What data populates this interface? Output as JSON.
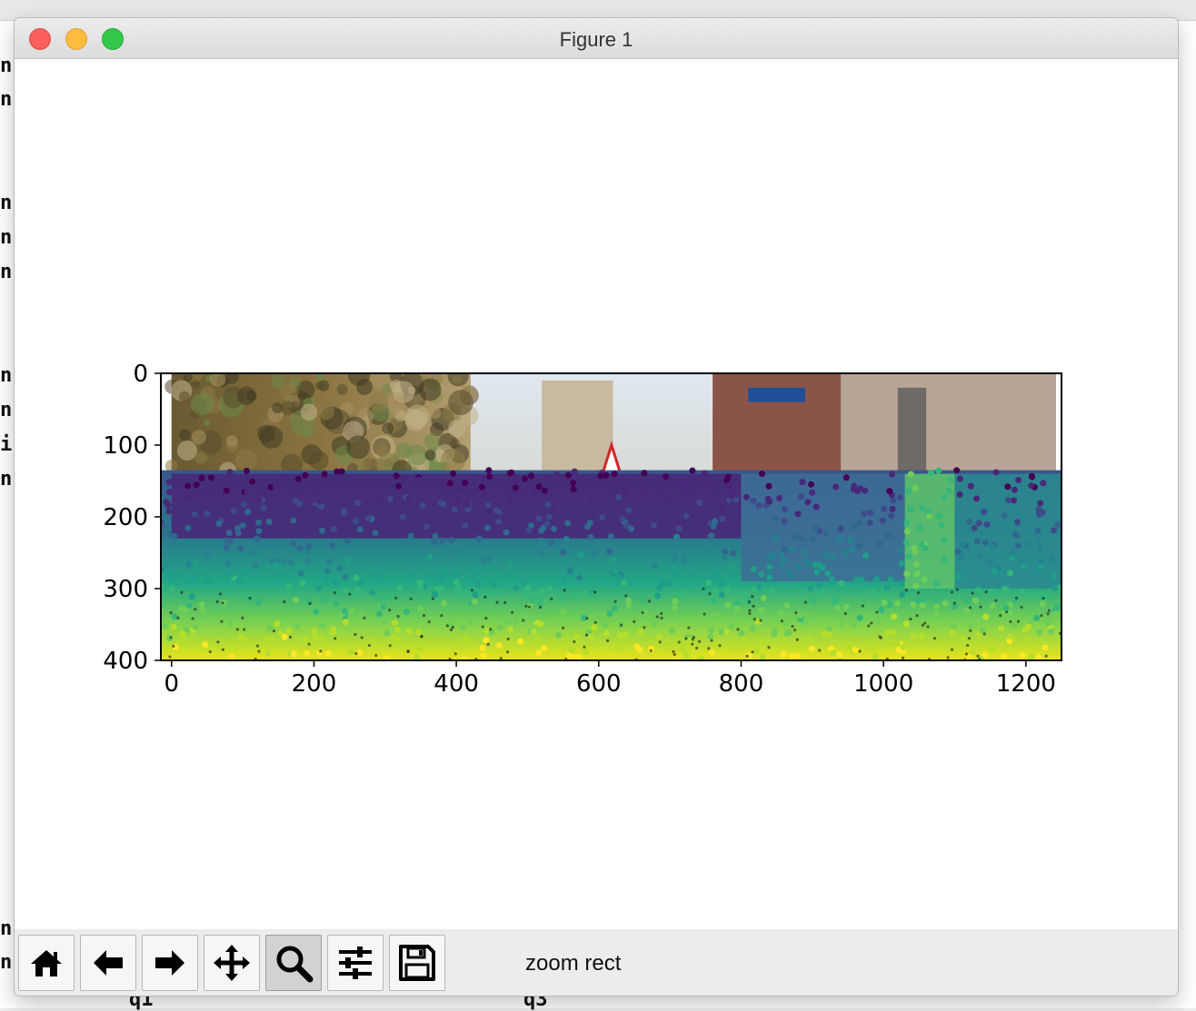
{
  "background": {
    "terminal_lines": [
      "n",
      "n",
      "n",
      "n",
      "n",
      "n",
      "n",
      "i",
      "n",
      "n",
      "n"
    ],
    "bottom_labels": [
      "q1",
      "q3"
    ]
  },
  "window": {
    "title": "Figure 1"
  },
  "toolbar": {
    "buttons": [
      {
        "name": "home",
        "icon": "home-icon"
      },
      {
        "name": "back",
        "icon": "arrow-left-icon"
      },
      {
        "name": "forward",
        "icon": "arrow-right-icon"
      },
      {
        "name": "pan",
        "icon": "move-icon"
      },
      {
        "name": "zoom",
        "icon": "magnifier-icon",
        "active": true
      },
      {
        "name": "configure-subplots",
        "icon": "sliders-icon"
      },
      {
        "name": "save",
        "icon": "floppy-icon"
      }
    ],
    "status_text": "zoom rect"
  },
  "chart_data": {
    "type": "scatter",
    "title": "",
    "xlabel": "",
    "ylabel": "",
    "xlim": [
      -15,
      1250
    ],
    "ylim": [
      400,
      0
    ],
    "y_inverted": true,
    "x_ticks": [
      0,
      200,
      400,
      600,
      800,
      1000,
      1200
    ],
    "y_ticks": [
      0,
      100,
      200,
      300,
      400
    ],
    "x_tick_labels": [
      "0",
      "200",
      "400",
      "600",
      "800",
      "1000",
      "1200"
    ],
    "y_tick_labels": [
      "0",
      "100",
      "200",
      "300",
      "400"
    ],
    "background_image": {
      "x_range": [
        0,
        1242
      ],
      "y_range": [
        0,
        375
      ]
    },
    "points": {
      "x_range": [
        -15,
        1250
      ],
      "y_range": [
        135,
        400
      ]
    },
    "colormap": "viridis",
    "colormap_stops": [
      "#440154",
      "#482878",
      "#3e4a89",
      "#31688e",
      "#26828e",
      "#1f9e89",
      "#35b779",
      "#6ece58",
      "#b5de2b",
      "#fde725"
    ],
    "grid": false
  }
}
